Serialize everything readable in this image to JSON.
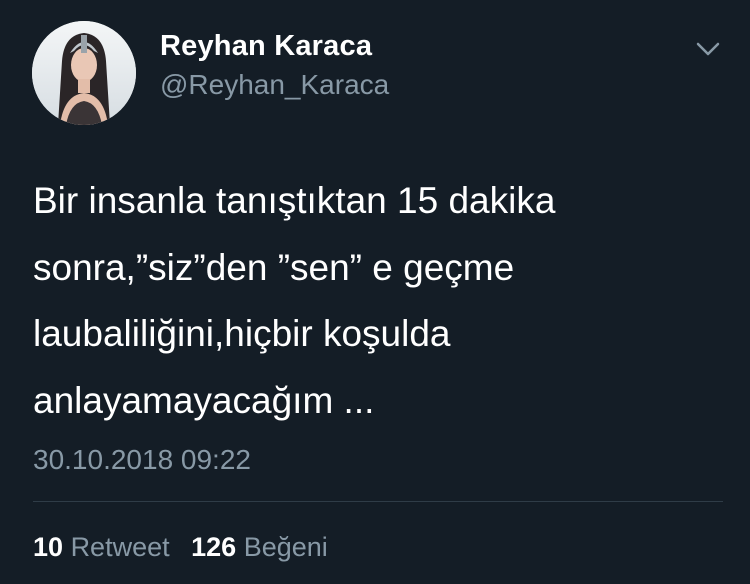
{
  "colors": {
    "background": "#141d26",
    "primary_text": "#ffffff",
    "secondary_text": "#8899a6",
    "divider": "#2f3c47"
  },
  "author": {
    "display_name": "Reyhan Karaca",
    "handle": "@Reyhan_Karaca",
    "avatar_icon": "profile-photo"
  },
  "menu": {
    "icon": "chevron-down-icon"
  },
  "tweet": {
    "lines": [
      "Bir insanla tanıştıktan 15 dakika",
      "sonra,”siz”den ”sen” e geçme",
      "laubaliliğini,hiçbir koşulda",
      "anlayamayacağım ..."
    ],
    "timestamp": "30.10.2018 09:22"
  },
  "stats": {
    "retweets": {
      "count": "10",
      "label": "Retweet"
    },
    "likes": {
      "count": "126",
      "label": "Beğeni"
    }
  }
}
